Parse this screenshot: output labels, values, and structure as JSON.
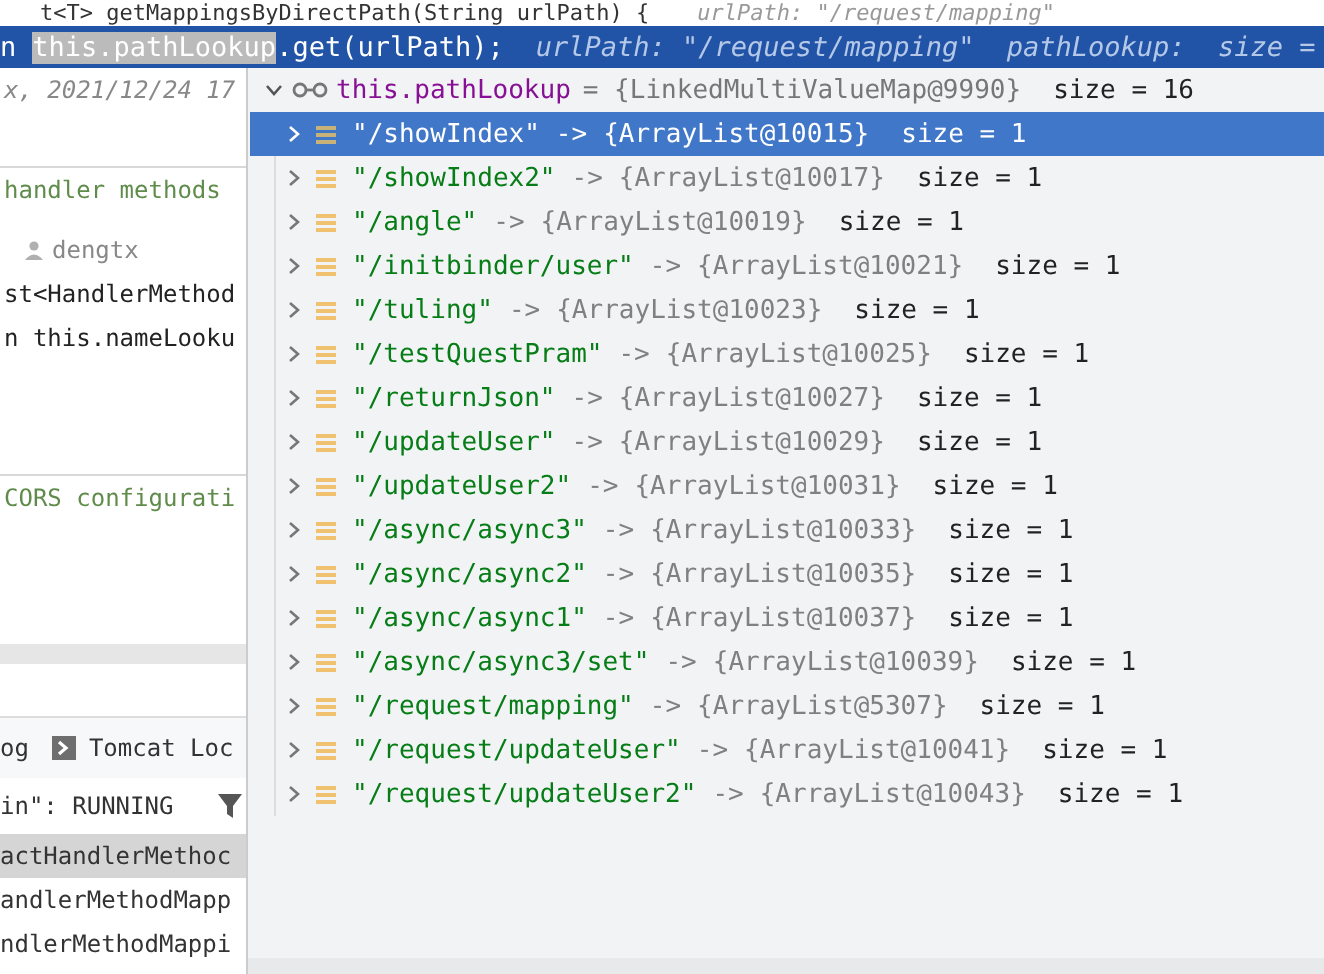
{
  "top_line": {
    "code": "t<T> getMappingsByDirectPath(String urlPath) {",
    "hint": "urlPath: \"/request/mapping\""
  },
  "current_line": {
    "prefix": "n",
    "highlight": "this.pathLookup",
    "rest": ".get(urlPath);",
    "hints": [
      "urlPath: \"/request/mapping\"",
      "pathLookup:  size ="
    ]
  },
  "editor_lines": [
    {
      "kind": "annotation",
      "text": "x, 2021/12/24 17"
    },
    {
      "kind": "comment",
      "text": "handler methods"
    },
    {
      "kind": "author",
      "text": "dengtx"
    },
    {
      "kind": "code",
      "text": "st<HandlerMethod"
    },
    {
      "kind": "code",
      "text": "n this.nameLooku"
    },
    {
      "kind": "comment",
      "text": "CORS configurati"
    }
  ],
  "console": {
    "tabs": [
      {
        "label": "og",
        "selected": false,
        "icon": false
      },
      {
        "label": "Tomcat Loc",
        "selected": false,
        "icon": true
      }
    ],
    "status": "in\": RUNNING",
    "frames": [
      {
        "text": "actHandlerMethoc",
        "selected": true
      },
      {
        "text": "andlerMethodMapp",
        "selected": false
      },
      {
        "text": "ndlerMethodMappi",
        "selected": false
      }
    ]
  },
  "popup": {
    "expanded": true,
    "name": "this.pathLookup",
    "value": "= {LinkedMultiValueMap@9990}",
    "size": "size = 16",
    "rows": [
      {
        "key": "\"/showIndex\"",
        "arrow": "->",
        "ref": "{ArrayList@10015}",
        "size": "size = 1",
        "selected": true
      },
      {
        "key": "\"/showIndex2\"",
        "arrow": "->",
        "ref": "{ArrayList@10017}",
        "size": "size = 1",
        "selected": false
      },
      {
        "key": "\"/angle\"",
        "arrow": "->",
        "ref": "{ArrayList@10019}",
        "size": "size = 1",
        "selected": false
      },
      {
        "key": "\"/initbinder/user\"",
        "arrow": "->",
        "ref": "{ArrayList@10021}",
        "size": "size = 1",
        "selected": false
      },
      {
        "key": "\"/tuling\"",
        "arrow": "->",
        "ref": "{ArrayList@10023}",
        "size": "size = 1",
        "selected": false
      },
      {
        "key": "\"/testQuestPram\"",
        "arrow": "->",
        "ref": "{ArrayList@10025}",
        "size": "size = 1",
        "selected": false
      },
      {
        "key": "\"/returnJson\"",
        "arrow": "->",
        "ref": "{ArrayList@10027}",
        "size": "size = 1",
        "selected": false
      },
      {
        "key": "\"/updateUser\"",
        "arrow": "->",
        "ref": "{ArrayList@10029}",
        "size": "size = 1",
        "selected": false
      },
      {
        "key": "\"/updateUser2\"",
        "arrow": "->",
        "ref": "{ArrayList@10031}",
        "size": "size = 1",
        "selected": false
      },
      {
        "key": "\"/async/async3\"",
        "arrow": "->",
        "ref": "{ArrayList@10033}",
        "size": "size = 1",
        "selected": false
      },
      {
        "key": "\"/async/async2\"",
        "arrow": "->",
        "ref": "{ArrayList@10035}",
        "size": "size = 1",
        "selected": false
      },
      {
        "key": "\"/async/async1\"",
        "arrow": "->",
        "ref": "{ArrayList@10037}",
        "size": "size = 1",
        "selected": false
      },
      {
        "key": "\"/async/async3/set\"",
        "arrow": "->",
        "ref": "{ArrayList@10039}",
        "size": "size = 1",
        "selected": false
      },
      {
        "key": "\"/request/mapping\"",
        "arrow": "->",
        "ref": "{ArrayList@5307}",
        "size": "size = 1",
        "selected": false
      },
      {
        "key": "\"/request/updateUser\"",
        "arrow": "->",
        "ref": "{ArrayList@10041}",
        "size": "size = 1",
        "selected": false
      },
      {
        "key": "\"/request/updateUser2\"",
        "arrow": "->",
        "ref": "{ArrayList@10043}",
        "size": "size = 1",
        "selected": false
      }
    ]
  }
}
